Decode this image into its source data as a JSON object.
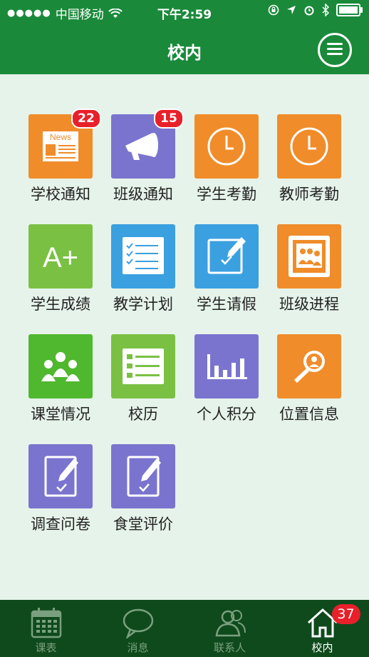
{
  "status_bar": {
    "carrier": "中国移动",
    "time": "下午2:59",
    "battery_level": 0.85
  },
  "nav": {
    "title": "校内",
    "menu_icon": "hamburger-menu-icon"
  },
  "apps": [
    {
      "label": "学校通知",
      "icon": "news-icon",
      "color": "#f08c2a",
      "badge": "22",
      "icon_text": "News"
    },
    {
      "label": "班级通知",
      "icon": "megaphone-icon",
      "color": "#7a74cf",
      "badge": "15"
    },
    {
      "label": "学生考勤",
      "icon": "clock-icon",
      "color": "#f08c2a"
    },
    {
      "label": "教师考勤",
      "icon": "clock-icon",
      "color": "#f08c2a"
    },
    {
      "label": "学生成绩",
      "icon": "grade-icon",
      "color": "#7ac143",
      "icon_text": "A+"
    },
    {
      "label": "教学计划",
      "icon": "checklist-icon",
      "color": "#3aa0e0"
    },
    {
      "label": "学生请假",
      "icon": "edit-checkbox-icon",
      "color": "#3aa0e0"
    },
    {
      "label": "班级进程",
      "icon": "class-photo-icon",
      "color": "#f08c2a"
    },
    {
      "label": "课堂情况",
      "icon": "group-icon",
      "color": "#4fb82e"
    },
    {
      "label": "校历",
      "icon": "list-icon",
      "color": "#7ac143"
    },
    {
      "label": "个人积分",
      "icon": "bar-chart-icon",
      "color": "#7a74cf"
    },
    {
      "label": "位置信息",
      "icon": "location-search-icon",
      "color": "#f08c2a"
    },
    {
      "label": "调查问卷",
      "icon": "survey-icon",
      "color": "#7a74cf"
    },
    {
      "label": "食堂评价",
      "icon": "survey-icon",
      "color": "#7a74cf"
    }
  ],
  "tabs": [
    {
      "label": "课表",
      "icon": "calendar-icon"
    },
    {
      "label": "消息",
      "icon": "chat-bubble-icon"
    },
    {
      "label": "联系人",
      "icon": "contacts-icon"
    },
    {
      "label": "校内",
      "icon": "home-icon",
      "active": true,
      "badge": "37"
    }
  ],
  "colors": {
    "header_green": "#1a8a3a",
    "tabbar_green": "#0f4a1c",
    "background": "#e6f3ea",
    "badge_red": "#e8202a"
  }
}
